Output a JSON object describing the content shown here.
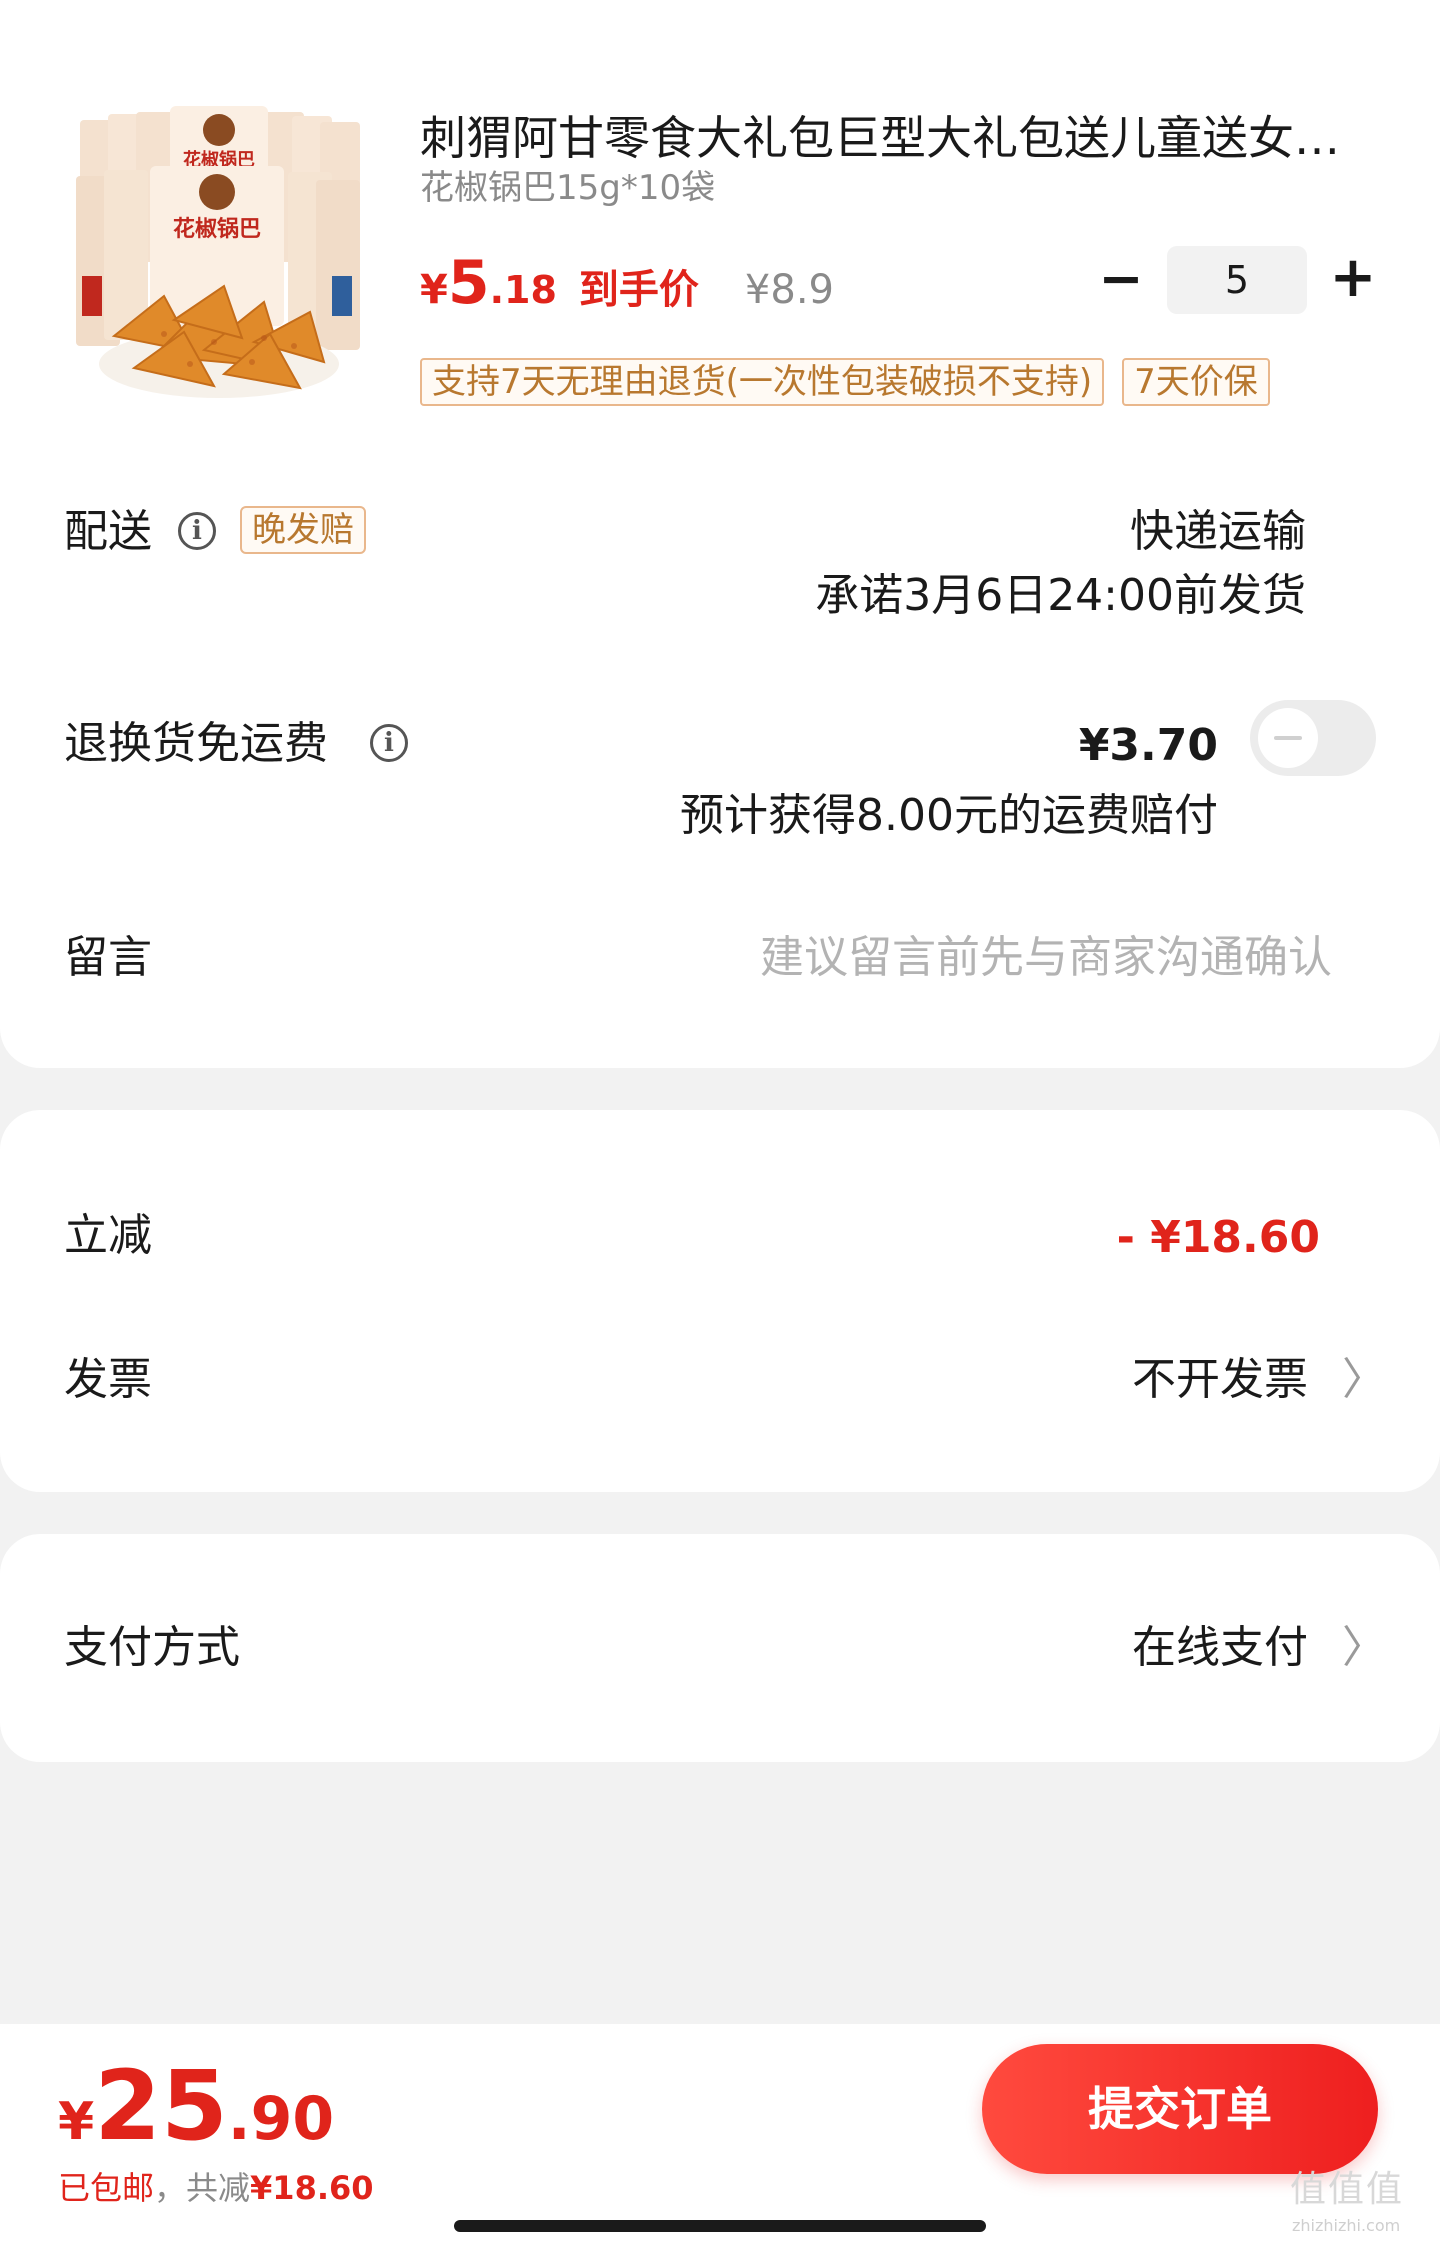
{
  "product": {
    "title": "刺猬阿甘零食大礼包巨型大礼包送儿童送女…",
    "spec": "花椒锅巴15g*10袋",
    "price_symbol": "¥",
    "price_int": "5",
    "price_dec": ".18",
    "price_label": "到手价",
    "original_price": "¥8.9",
    "quantity": "5",
    "minus_symbol": "−",
    "plus_symbol": "+",
    "tags": [
      "支持7天无理由退货(一次性包装破损不支持)",
      "7天价保"
    ],
    "package_brand_text": "花椒锅巴"
  },
  "delivery": {
    "label": "配送",
    "info_icon": "i",
    "late_tag": "晚发赔",
    "method": "快递运输",
    "promise": "承诺3月6日24:00前发货"
  },
  "return_shipping": {
    "label": "退换货免运费",
    "info_icon": "i",
    "price": "¥3.70",
    "note": "预计获得8.00元的运费赔付",
    "toggle_on": false
  },
  "message": {
    "label": "留言",
    "placeholder": "建议留言前先与商家沟通确认"
  },
  "discount": {
    "label": "立减",
    "value": "- ¥18.60"
  },
  "invoice": {
    "label": "发票",
    "value": "不开发票",
    "chevron": "〉"
  },
  "payment": {
    "label": "支付方式",
    "value": "在线支付",
    "chevron": "〉"
  },
  "bottom": {
    "total_symbol": "¥",
    "total_int": "25",
    "total_dec": ".90",
    "summary_prefix": "已包邮",
    "summary_mid": "，共减",
    "summary_amount": "¥18.60",
    "submit_label": "提交订单"
  },
  "watermark": {
    "text": "值值值",
    "sub": "zhizhizhi.com"
  },
  "colors": {
    "accent_red": "#e0241b",
    "tag_orange": "#b8782f",
    "background": "#f2f2f2"
  }
}
